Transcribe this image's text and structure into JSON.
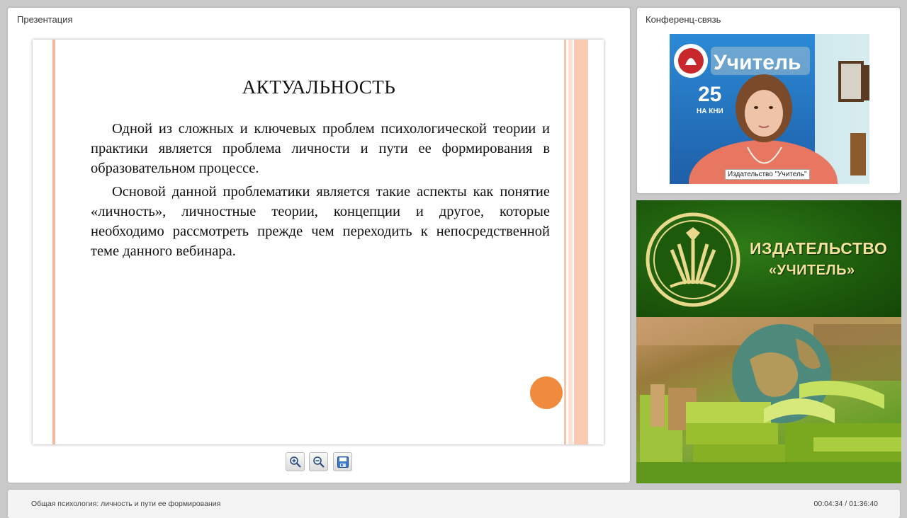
{
  "presentation": {
    "title": "Презентация",
    "slide": {
      "heading": "АКТУАЛЬНОСТЬ",
      "paragraphs": [
        "Одной из сложных и ключевых проблем психологической теории и практики является проблема личности и пути ее формирования в образовательном процессе.",
        "Основой данной проблематики является такие аспекты как понятие «личность», личностные теории, концепции и другое, которые необходимо рассмотреть прежде чем переходить к непосредственной теме данного вебинара."
      ]
    },
    "toolbar": [
      "zoom-in-icon",
      "zoom-out-icon",
      "save-icon"
    ]
  },
  "conference": {
    "title": "Конференц-связь",
    "video_label": "Издательство \"Учитель\"",
    "background_sign": "Учитель",
    "background_number": "25",
    "background_caption": "НА КНИ"
  },
  "publisher_banner": {
    "line1": "ИЗДАТЕЛЬСТВО",
    "line2": "«УЧИТЕЛЬ»",
    "colors": {
      "green": "#1d5a0c",
      "text": "#f2e29c"
    }
  },
  "status_bar": {
    "webinar_title": "Общая психология: личность и пути ее формирования",
    "time": "00:04:34 / 01:36:40"
  },
  "colors": {
    "accent_orange": "#f08a3c",
    "slide_stripe": "#f3b9a0"
  }
}
